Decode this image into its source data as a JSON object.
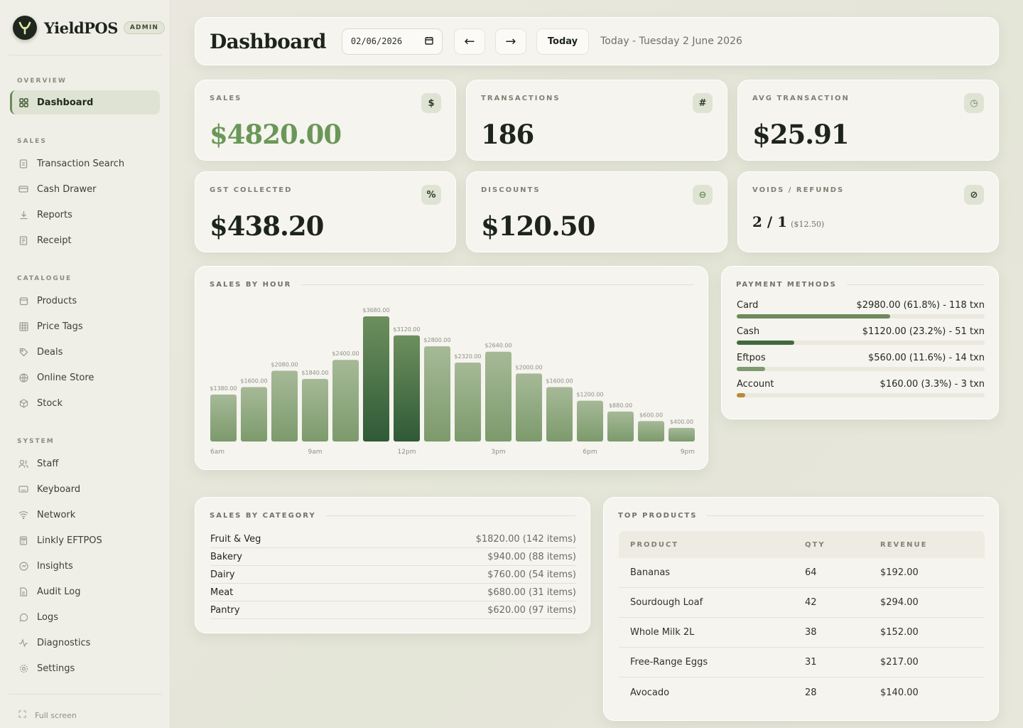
{
  "app": {
    "name": "YieldPOS",
    "role_badge": "ADMIN"
  },
  "sidebar": {
    "sections": [
      {
        "label": "OVERVIEW",
        "items": [
          {
            "label": "Dashboard",
            "icon": "grid-icon",
            "active": true
          }
        ]
      },
      {
        "label": "SALES",
        "items": [
          {
            "label": "Transaction Search",
            "icon": "document-icon"
          },
          {
            "label": "Cash Drawer",
            "icon": "drawer-icon"
          },
          {
            "label": "Reports",
            "icon": "download-icon"
          },
          {
            "label": "Receipt",
            "icon": "receipt-icon"
          }
        ]
      },
      {
        "label": "CATALOGUE",
        "items": [
          {
            "label": "Products",
            "icon": "box-icon"
          },
          {
            "label": "Price Tags",
            "icon": "table-icon"
          },
          {
            "label": "Deals",
            "icon": "tag-icon"
          },
          {
            "label": "Online Store",
            "icon": "globe-icon"
          },
          {
            "label": "Stock",
            "icon": "cube-icon"
          }
        ]
      },
      {
        "label": "SYSTEM",
        "items": [
          {
            "label": "Staff",
            "icon": "users-icon"
          },
          {
            "label": "Keyboard",
            "icon": "keyboard-icon"
          },
          {
            "label": "Network",
            "icon": "wifi-icon"
          },
          {
            "label": "Linkly EFTPOS",
            "icon": "terminal-icon"
          },
          {
            "label": "Insights",
            "icon": "insights-icon"
          },
          {
            "label": "Audit Log",
            "icon": "file-icon"
          },
          {
            "label": "Logs",
            "icon": "chat-icon"
          },
          {
            "label": "Diagnostics",
            "icon": "pulse-icon"
          },
          {
            "label": "Settings",
            "icon": "gear-icon"
          }
        ]
      }
    ],
    "fullscreen_label": "Full screen"
  },
  "header": {
    "title": "Dashboard",
    "date_value": "02/06/2026",
    "prev_label": "←",
    "next_label": "→",
    "today_label": "Today",
    "today_text": "Today - Tuesday 2 June 2026"
  },
  "stats": {
    "sales": {
      "label": "SALES",
      "value": "$4820.00",
      "icon_glyph": "$"
    },
    "transactions": {
      "label": "TRANSACTIONS",
      "value": "186",
      "icon_glyph": "#"
    },
    "avg": {
      "label": "AVG TRANSACTION",
      "value": "$25.91",
      "icon_glyph": "◷"
    },
    "gst": {
      "label": "GST COLLECTED",
      "value": "$438.20",
      "icon_glyph": "%"
    },
    "discounts": {
      "label": "DISCOUNTS",
      "value": "$120.50",
      "icon_glyph": "⊖"
    },
    "voids": {
      "label": "VOIDS / REFUNDS",
      "value": "2 / 1",
      "sub": "($12.50)",
      "icon_glyph": "⊘"
    }
  },
  "sales_by_hour": {
    "title": "SALES BY HOUR",
    "chart_data": {
      "type": "bar",
      "categories": [
        "6am",
        "7am",
        "8am",
        "9am",
        "10am",
        "11am",
        "12pm",
        "1pm",
        "2pm",
        "3pm",
        "4pm",
        "5pm",
        "6pm",
        "7pm",
        "8pm",
        "9pm"
      ],
      "values": [
        1380,
        1600,
        2080,
        1840,
        2400,
        3680,
        3120,
        2800,
        2320,
        2640,
        2000,
        1600,
        1200,
        880,
        600,
        400
      ],
      "value_labels": [
        "$1380.00",
        "$1600.00",
        "$2080.00",
        "$1840.00",
        "$2400.00",
        "$3680.00",
        "$3120.00",
        "$2800.00",
        "$2320.00",
        "$2640.00",
        "$2000.00",
        "$1600.00",
        "$1200.00",
        "$880.00",
        "$600.00",
        "$400.00"
      ],
      "tick_labels": [
        {
          "index": 0,
          "label": "6am"
        },
        {
          "index": 3,
          "label": "9am"
        },
        {
          "index": 6,
          "label": "12pm"
        },
        {
          "index": 9,
          "label": "3pm"
        },
        {
          "index": 12,
          "label": "6pm"
        },
        {
          "index": 15,
          "label": "9pm"
        }
      ],
      "highlight_indices": [
        5,
        6
      ],
      "colors": {
        "bar_top": "#a6b997",
        "bar_bottom": "#7c9a6c",
        "peak_top": "#6d8f5e",
        "peak_bottom": "#2f5a36"
      }
    }
  },
  "payment_methods": {
    "title": "PAYMENT METHODS",
    "items": [
      {
        "name": "Card",
        "summary": "$2980.00 (61.8%) - 118 txn",
        "percent": 61.8,
        "color": "#6e8a5e"
      },
      {
        "name": "Cash",
        "summary": "$1120.00 (23.2%) - 51 txn",
        "percent": 23.2,
        "color": "#3f6a3f"
      },
      {
        "name": "Eftpos",
        "summary": "$560.00 (11.6%) - 14 txn",
        "percent": 11.6,
        "color": "#7f9a70"
      },
      {
        "name": "Account",
        "summary": "$160.00 (3.3%) - 3 txn",
        "percent": 3.3,
        "color": "#b8893f"
      }
    ]
  },
  "sales_by_category": {
    "title": "SALES BY CATEGORY",
    "rows": [
      {
        "name": "Fruit & Veg",
        "value": "$1820.00 (142 items)"
      },
      {
        "name": "Bakery",
        "value": "$940.00 (88 items)"
      },
      {
        "name": "Dairy",
        "value": "$760.00 (54 items)"
      },
      {
        "name": "Meat",
        "value": "$680.00 (31 items)"
      },
      {
        "name": "Pantry",
        "value": "$620.00 (97 items)"
      }
    ]
  },
  "top_products": {
    "title": "TOP PRODUCTS",
    "columns": [
      "PRODUCT",
      "QTY",
      "REVENUE"
    ],
    "rows": [
      {
        "product": "Bananas",
        "qty": "64",
        "revenue": "$192.00"
      },
      {
        "product": "Sourdough Loaf",
        "qty": "42",
        "revenue": "$294.00"
      },
      {
        "product": "Whole Milk 2L",
        "qty": "38",
        "revenue": "$152.00"
      },
      {
        "product": "Free-Range Eggs",
        "qty": "31",
        "revenue": "$217.00"
      },
      {
        "product": "Avocado",
        "qty": "28",
        "revenue": "$140.00"
      }
    ]
  }
}
